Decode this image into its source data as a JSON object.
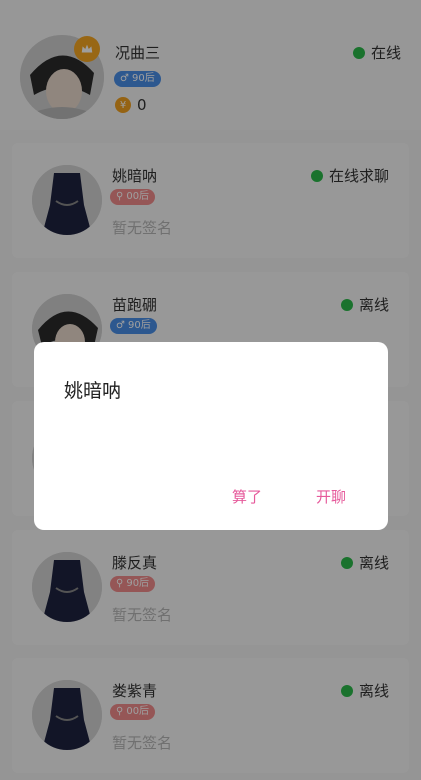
{
  "header": {
    "moon_icon": "moon-icon",
    "gear_icon": "gear-icon"
  },
  "me": {
    "name": "况曲三",
    "tag": "90后",
    "coins": "0",
    "status": "在线"
  },
  "users": [
    {
      "name": "姚暗呐",
      "tag": "00后",
      "gender": "female",
      "status": "在线求聊",
      "signature": "暂无签名"
    },
    {
      "name": "苗跑硼",
      "tag": "90后",
      "gender": "male",
      "status": "离线",
      "signature": ""
    },
    {
      "name": "",
      "tag": "",
      "gender": "female",
      "status": "",
      "signature": ""
    },
    {
      "name": "滕反真",
      "tag": "90后",
      "gender": "female",
      "status": "离线",
      "signature": "暂无签名"
    },
    {
      "name": "娄紫青",
      "tag": "00后",
      "gender": "female",
      "status": "离线",
      "signature": "暂无签名"
    }
  ],
  "dialog": {
    "title": "姚暗呐",
    "cancel_label": "算了",
    "confirm_label": "开聊"
  },
  "colors": {
    "accent": "#e65a9b",
    "online": "#2bb94a",
    "male_tag": "#4a8fe7",
    "female_tag": "#f08c8c"
  }
}
